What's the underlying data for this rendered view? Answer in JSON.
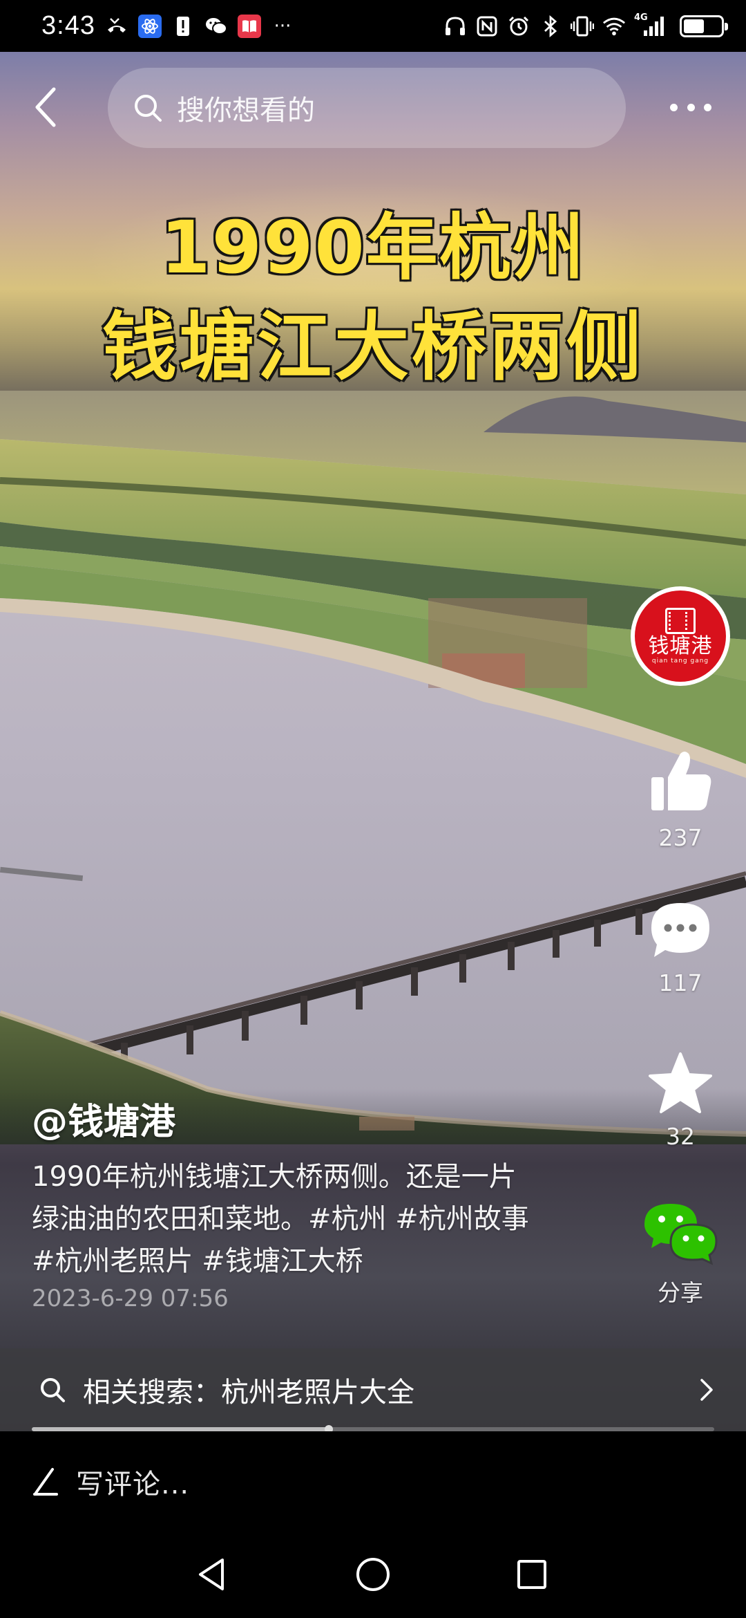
{
  "status_bar": {
    "time": "3:43",
    "more_indicator": "···",
    "network_label": "4G",
    "battery_level": 0.6,
    "left_icons": [
      "missed-call-icon",
      "atom-app-icon",
      "alert-icon",
      "wechat-icon",
      "book-app-icon"
    ],
    "right_icons": [
      "headphones-icon",
      "nfc-icon",
      "alarm-icon",
      "bluetooth-icon",
      "vibrate-icon",
      "wifi-icon",
      "signal-icon",
      "battery-icon"
    ]
  },
  "header": {
    "search_placeholder": "搜你想看的",
    "icons": [
      "back-arrow-icon",
      "search-icon",
      "more-dots-icon"
    ]
  },
  "video": {
    "title_line1": "1990年杭州",
    "title_line2": "钱塘江大桥两侧"
  },
  "channel": {
    "avatar_text": "钱塘港",
    "avatar_subtext": "qian tang gang"
  },
  "actions": {
    "like_count": "237",
    "comment_count": "117",
    "favorite_count": "32",
    "share_label": "分享"
  },
  "post": {
    "author": "@钱塘港",
    "caption_lines": [
      "1990年杭州钱塘江大桥两侧。还是一片",
      "绿油油的农田和菜地。#杭州 #杭州故事",
      "#杭州老照片 #钱塘江大桥"
    ],
    "date": "2023-6-29 07:56"
  },
  "related_search": {
    "label": "相关搜索：杭州老照片大全"
  },
  "playback": {
    "progress": 0.435
  },
  "comment": {
    "placeholder": "写评论..."
  },
  "colors": {
    "title_yellow": "#ffe23a",
    "avatar_red": "#d8111c",
    "wechat_green": "#2dc100"
  }
}
